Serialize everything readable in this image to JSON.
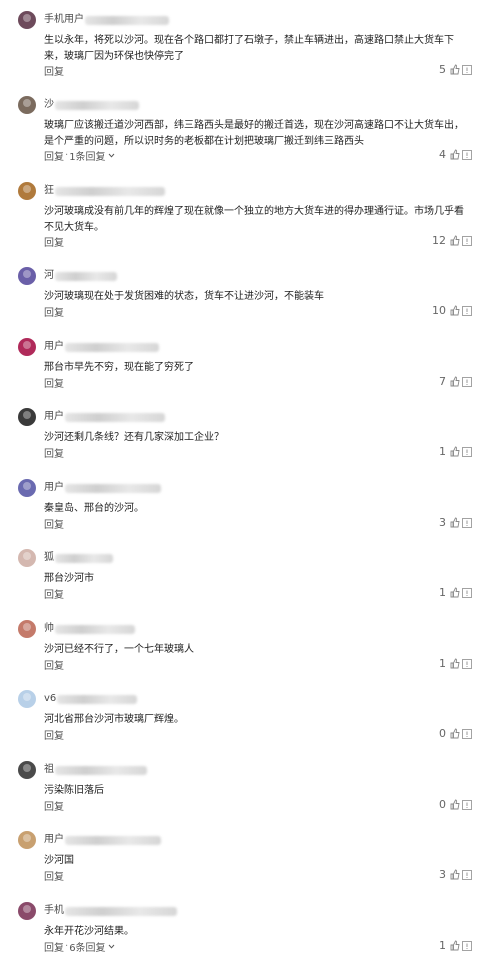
{
  "icons": {
    "like": "thumbs-up-icon",
    "report": "report-icon",
    "expand": "chevron-down-icon"
  },
  "colors": {
    "text": "#222222",
    "meta": "#555555",
    "blur": "#d6d6d6"
  },
  "comments": [
    {
      "username": "手机用户",
      "text": "生以永年，将死以沙河。现在各个路口都打了石墩子，禁止车辆进出，高速路口禁止大货车下来，玻璃厂因为环保也快停完了",
      "reply": "回复",
      "replies": "",
      "likes": "5",
      "avatar_color": "#6d4a5b"
    },
    {
      "username": "沙",
      "text": "玻璃厂应该搬迁道沙河西部，纬三路西头是最好的搬迁首选，现在沙河高速路口不让大货车出，是个严重的问题，所以识时务的老板都在计划把玻璃厂搬迁到纬三路西头",
      "reply": "回复",
      "replies": "1条回复",
      "likes": "4",
      "avatar_color": "#7b6b5e"
    },
    {
      "username": "狂",
      "text": "沙河玻璃成没有前几年的辉煌了现在就像一个独立的地方大货车进的得办理通行证。市场几乎看不见大货车。",
      "reply": "回复",
      "replies": "",
      "likes": "12",
      "avatar_color": "#b07a3c"
    },
    {
      "username": "河",
      "text": "沙河玻璃现在处于发货困难的状态，货车不让进沙河，不能装车",
      "reply": "回复",
      "replies": "",
      "likes": "10",
      "avatar_color": "#6a5fa8"
    },
    {
      "username": "用户",
      "text": "邢台市早先不穷，现在能了穷死了",
      "reply": "回复",
      "replies": "",
      "likes": "7",
      "avatar_color": "#b02a5a"
    },
    {
      "username": "用户",
      "text": "沙河还剩几条线？还有几家深加工企业？",
      "reply": "回复",
      "replies": "",
      "likes": "1",
      "avatar_color": "#3a3a3a"
    },
    {
      "username": "用户",
      "text": "秦皇岛、邢台的沙河。",
      "reply": "回复",
      "replies": "",
      "likes": "3",
      "avatar_color": "#6a6ab0"
    },
    {
      "username": "狐",
      "text": "邢台沙河市",
      "reply": "回复",
      "replies": "",
      "likes": "1",
      "avatar_color": "#d4b8b0"
    },
    {
      "username": "帅",
      "text": "沙河已经不行了，一个七年玻璃人",
      "reply": "回复",
      "replies": "",
      "likes": "1",
      "avatar_color": "#c47a6a"
    },
    {
      "username": "v6",
      "text": "河北省邢台沙河市玻璃厂辉煌。",
      "reply": "回复",
      "replies": "",
      "likes": "0",
      "avatar_color": "#b8d0e8"
    },
    {
      "username": "祖",
      "text": "污染陈旧落后",
      "reply": "回复",
      "replies": "",
      "likes": "0",
      "avatar_color": "#4a4a4a"
    },
    {
      "username": "用户",
      "text": "沙河国",
      "reply": "回复",
      "replies": "",
      "likes": "3",
      "avatar_color": "#c8a070"
    },
    {
      "username": "手机",
      "text": "永年开花沙河结果。",
      "reply": "回复",
      "replies": "6条回复",
      "likes": "1",
      "avatar_color": "#8a4a6a"
    }
  ]
}
